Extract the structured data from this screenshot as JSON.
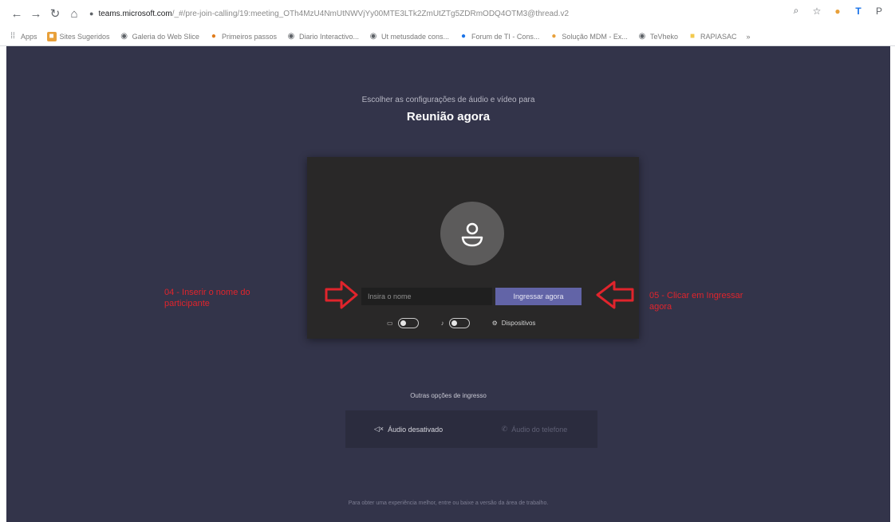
{
  "browser": {
    "url_host": "teams.microsoft.com",
    "url_path": "/_#/pre-join-calling/19:meeting_OTh4MzU4NmUtNWVjYy00MTE3LTk2ZmUtZTg5ZDRmODQ4OTM3@thread.v2",
    "bookmarks": [
      {
        "label": "Apps",
        "icon": "apps-grid-icon",
        "color": "#5f6368"
      },
      {
        "label": "Sites Sugeridos",
        "icon": "bookmark-orange-icon",
        "color": "#e8a03a"
      },
      {
        "label": "Galeria do Web Slice",
        "icon": "globe-icon",
        "color": "#5f6368"
      },
      {
        "label": "Primeiros passos",
        "icon": "firefox-icon",
        "color": "#e07b1a"
      },
      {
        "label": "Diario Interactivo...",
        "icon": "globe-icon",
        "color": "#5f6368"
      },
      {
        "label": "Ut metusdade cons...",
        "icon": "globe-icon",
        "color": "#5f6368"
      },
      {
        "label": "Forum de TI - Cons...",
        "icon": "blue-circle-icon",
        "color": "#1a73e8"
      },
      {
        "label": "Solução MDM - Ex...",
        "icon": "orange-circle-icon",
        "color": "#e8a03a"
      },
      {
        "label": "TeVheko",
        "icon": "globe-icon",
        "color": "#5f6368"
      },
      {
        "label": "RAPIASAC",
        "icon": "folder-icon",
        "color": "#f2c94c"
      }
    ]
  },
  "prejoin": {
    "subtitle": "Escolher as configurações de áudio e vídeo para",
    "title": "Reunião agora",
    "name_placeholder": "Insira o nome",
    "join_label": "Ingressar agora",
    "devices_label": "Dispositivos",
    "other_title": "Outras opções de ingresso",
    "audio_off_label": "Áudio desativado",
    "phone_audio_label": "Áudio do telefone",
    "footer": "Para obter uma experiência melhor, entre ou baixe a versão da área de trabalho."
  },
  "annotations": {
    "left": "04 - Inserir o nome do participante",
    "right": "05 - Clicar em Ingressar agora",
    "color": "#e0242c"
  },
  "colors": {
    "page_bg": "#33344a",
    "panel_bg": "#292828",
    "accent": "#6264a7"
  }
}
